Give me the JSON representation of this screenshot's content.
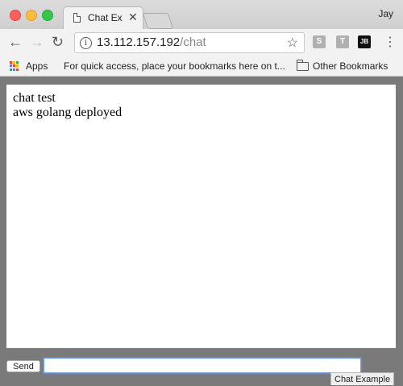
{
  "window": {
    "tab_title": "Chat Ex",
    "tab_close": "✕",
    "profile_name": "Jay"
  },
  "toolbar": {
    "back_icon": "←",
    "forward_icon": "→",
    "reload_icon": "↻",
    "url_host": "13.112.157.192",
    "url_path": "/chat",
    "info_glyph": "i",
    "star_icon": "☆",
    "extensions": [
      "S",
      "T",
      "JB"
    ],
    "menu_icon": "⋮"
  },
  "bookmarks": {
    "apps_label": "Apps",
    "hint": "For quick access, place your bookmarks here on t...",
    "other_label": "Other Bookmarks"
  },
  "chat": {
    "messages": [
      "chat test",
      "aws golang deployed"
    ],
    "send_label": "Send",
    "input_value": "",
    "status_text": "Chat Example"
  },
  "colors": {
    "apps_grid": [
      "#e94235",
      "#fbbc04",
      "#34a853",
      "#4285f4",
      "#e94235",
      "#fbbc04",
      "#34a853",
      "#4285f4",
      "#e94235"
    ]
  }
}
